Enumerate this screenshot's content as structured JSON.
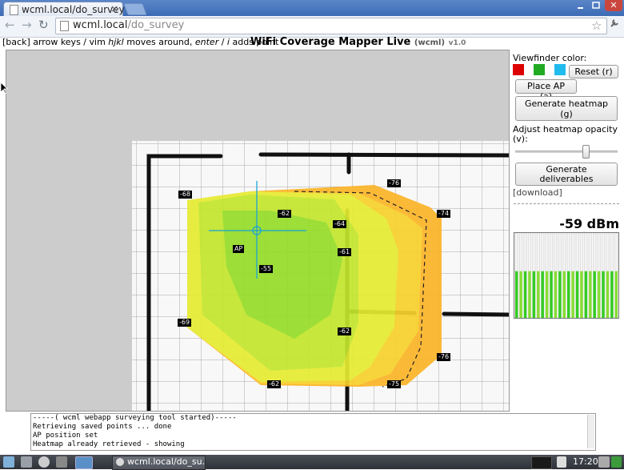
{
  "browser": {
    "tab_title": "wcml.local/do_survey",
    "tab_close": "×",
    "url_host": "wcml.local",
    "url_path": "/do_survey",
    "back_glyph": "←",
    "forward_glyph": "→",
    "reload_glyph": "↻",
    "star_glyph": "☆",
    "window_close": "✕"
  },
  "page": {
    "help_prefix": "[",
    "help_back": "back",
    "help_suffix": "] arrow keys / vim ",
    "help_hjkl": "hjkl",
    "help_moves": " moves around, ",
    "help_enter": "enter",
    "help_sep": " / ",
    "help_i": "i",
    "help_adds": " adds point",
    "title": "WiFi Coverage Mapper Live",
    "subtitle": "(wcml)",
    "version": "v1.0"
  },
  "map": {
    "ap_label": "AP",
    "points": [
      {
        "label": "-68"
      },
      {
        "label": "-76"
      },
      {
        "label": "-62"
      },
      {
        "label": "-64"
      },
      {
        "label": "-74"
      },
      {
        "label": "-61"
      },
      {
        "label": "-55"
      },
      {
        "label": "-69"
      },
      {
        "label": "-62"
      },
      {
        "label": "-76"
      },
      {
        "label": "-62"
      },
      {
        "label": "-75"
      }
    ],
    "heat_colors": {
      "green": "#96dc28",
      "yellow": "#e6ec32",
      "orange": "#fcb428"
    }
  },
  "panel": {
    "viewfinder_label": "Viewfinder color:",
    "swatches": [
      "#dd0000",
      "#22aa22",
      "#22bbee"
    ],
    "reset_button": "Reset (r)",
    "place_ap_button": "Place AP (a)",
    "generate_heatmap_line1": "Generate heatmap",
    "generate_heatmap_line2": "(g)",
    "opacity_label_line1": "Adjust heatmap opacity",
    "opacity_label_line2": "(v):",
    "opacity_value": 0.68,
    "deliverables_line1": "Generate",
    "deliverables_line2": "deliverables",
    "download_link": "[download]",
    "signal": "-59 dBm"
  },
  "signal_bars": [
    0.55,
    0.55,
    0.55,
    0.55,
    0.55,
    0.55,
    0.55,
    0.55,
    0.55,
    0.55,
    0.55,
    0.55,
    0.55,
    0.55,
    0.55,
    0.55,
    0.55,
    0.55,
    0.55,
    0.55,
    0.55,
    0.55,
    0.55,
    0.55
  ],
  "log": [
    "-----( wcml webapp surveying tool started)-----",
    "Retrieving saved points ... done",
    "AP position set",
    "Heatmap already retrieved - showing"
  ],
  "taskbar": {
    "task_title": "wcml.local/do_su...",
    "clock": "17:20"
  }
}
